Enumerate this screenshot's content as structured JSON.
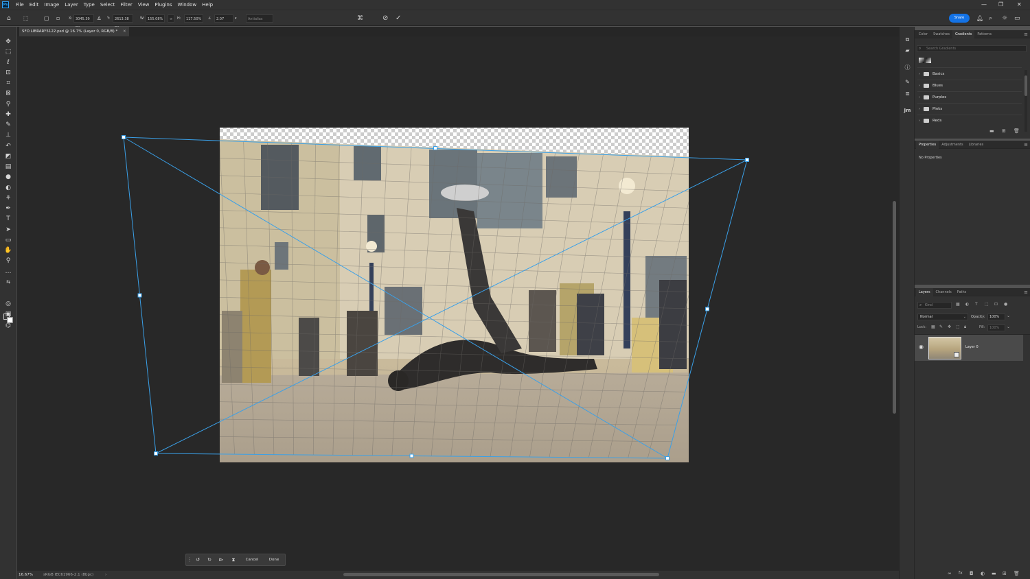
{
  "app": {
    "logo_text": "Ps"
  },
  "menu": [
    "File",
    "Edit",
    "Image",
    "Layer",
    "Type",
    "Select",
    "Filter",
    "View",
    "Plugins",
    "Window",
    "Help"
  ],
  "options": {
    "x_label": "X:",
    "x_value": "3045.39 px",
    "y_label": "Y:",
    "y_value": "2613.38 px",
    "w_label": "W:",
    "w_value": "155.08%",
    "h_label": "H:",
    "h_value": "117.50%",
    "angle_label": "∠",
    "angle_value": "2.07",
    "interp_label": "Antialias",
    "share_label": "Share"
  },
  "document": {
    "tab_title": "SFO LIBRARY5122.psd @ 16.7% (Layer 0, RGB/8) *"
  },
  "status": {
    "zoom": "16.67%",
    "profile": "sRGB IEC61966-2.1 (8bpc)"
  },
  "transform_bar": {
    "cancel_label": "Cancel",
    "done_label": "Done"
  },
  "gradients_panel": {
    "tabs": [
      "Color",
      "Swatches",
      "Gradients",
      "Patterns"
    ],
    "active_tab": "Gradients",
    "search_placeholder": "Search Gradients",
    "groups": [
      "Basics",
      "Blues",
      "Purples",
      "Pinks",
      "Reds"
    ]
  },
  "properties_panel": {
    "tabs": [
      "Properties",
      "Adjustments",
      "Libraries"
    ],
    "message": "No Properties"
  },
  "layers_panel": {
    "tabs": [
      "Layers",
      "Channels",
      "Paths"
    ],
    "kind_placeholder": "Kind",
    "blend_mode": "Normal",
    "opacity_label": "Opacity:",
    "opacity_value": "100%",
    "lock_label": "Lock:",
    "fill_label": "Fill:",
    "fill_value": "100%",
    "layer_name": "Layer 0"
  },
  "icons": {
    "strip_jm": "Jm"
  },
  "colors": {
    "accent": "#1473e6",
    "transform_line": "#3aa0e8",
    "panel_bg": "#323232",
    "canvas_bg": "#282828"
  }
}
